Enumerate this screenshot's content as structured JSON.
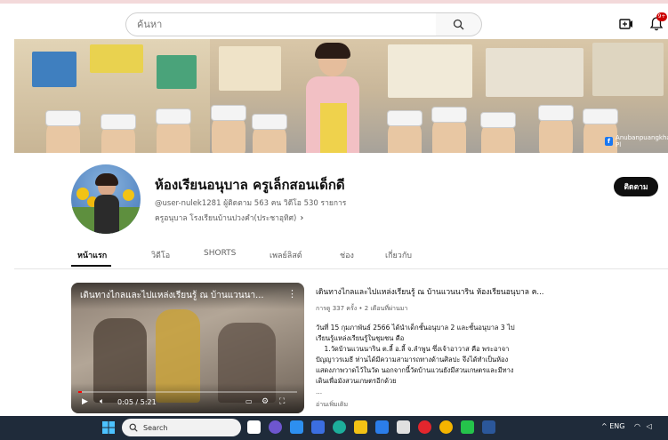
{
  "search": {
    "placeholder": "ค้นหา"
  },
  "notifications": {
    "badge": "9+"
  },
  "banner": {
    "fb_handle": "Anubanpuangkham Pl"
  },
  "channel": {
    "name": "ห้องเรียนอนุบาล ครูเล็กสอนเด็กดี",
    "meta": "@user-nulek1281  ผู้ติดตาม 563 คน  วิดีโอ 530 รายการ",
    "link": "ครูอนุบาล โรงเรียนบ้านปวงคำ(ประชาอุทิศ)",
    "subscribe_label": "ติดตาม"
  },
  "tabs": [
    {
      "label": "หน้าแรก",
      "active": true
    },
    {
      "label": "วิดีโอ"
    },
    {
      "label": "SHORTS"
    },
    {
      "label": "เพลย์ลิสต์"
    },
    {
      "label": "ช่อง"
    },
    {
      "label": "เกี่ยวกับ"
    }
  ],
  "featured": {
    "overlay_title": "เดินทางไกลและไปแหล่งเรียนรู้ ณ บ้านแวนนา...",
    "time": "0:05 / 5:21",
    "progress": 0.016,
    "title": "เดินทางไกลและไปแหล่งเรียนรู้ ณ บ้านแวนนาริน  ห้องเรียนอนุบาล ค...",
    "meta": "การดู 337 ครั้ง • 2 เดือนที่ผ่านมา",
    "desc_lines": [
      "วันที่ 15 กุมภาพันธ์ 2566 ได้นำเด็กชั้นอนุบาล 2 และชั้นอนุบาล 3 ไป",
      "เรียนรู้แหล่งเรียนรู้ในชุมชน คือ",
      "    1.วัดบ้านแวนนาริน ต.ลี้ อ.ลี้ จ.ลำพูน ซึ่งเจ้าอาวาส คือ พระอาจา",
      "ปัญญาวรเมธี ท่านได้มีความสามารถทางด้านศิลปะ จึงได้ทำเป็นห้อง",
      "แสดงภาพวาดไว้ในวัด นอกจากนี้วัดบ้านแวนยังมีสวนเกษตรและมีทาง",
      "เดินเพื่อมังสวนเกษตรอีกด้วย"
    ],
    "ellipsis": "...",
    "read_more": "อ่านเพิ่มเติม"
  },
  "taskbar": {
    "search_label": "Search",
    "tray": "^  ENG"
  },
  "colors": {
    "subscribe_bg": "#0f0f0f",
    "progress": "#ff0000",
    "taskbar": "#1f2b3a"
  }
}
